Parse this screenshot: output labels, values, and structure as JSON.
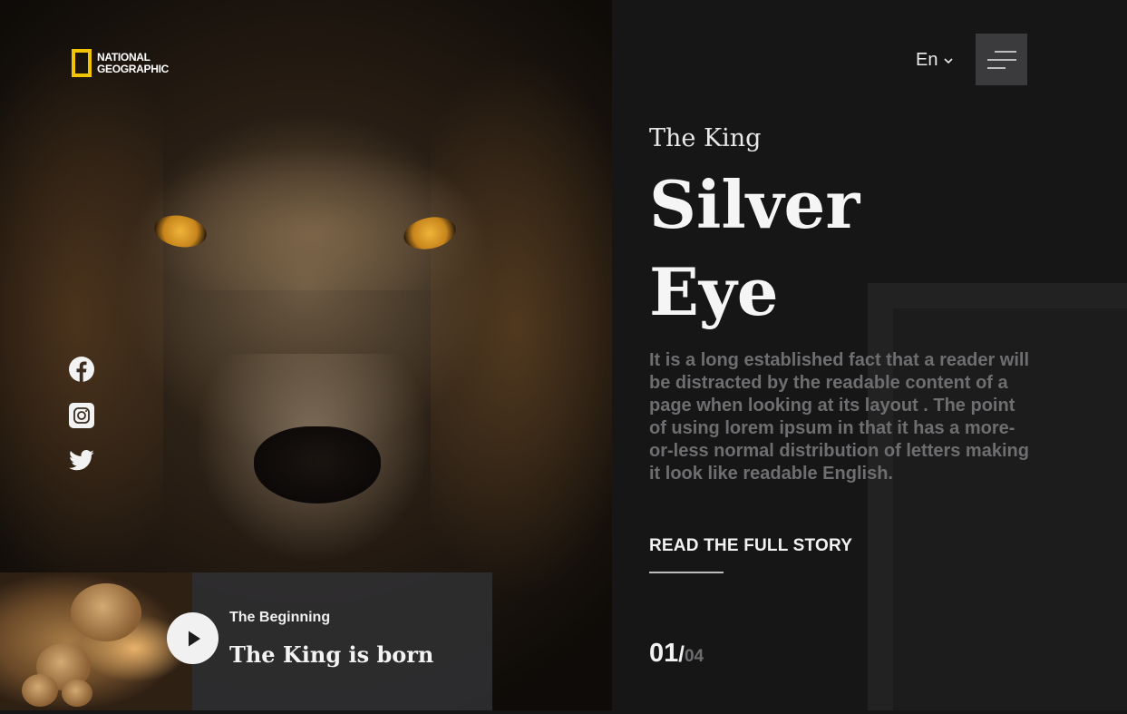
{
  "brand": {
    "logo_text_line1": "NATIONAL",
    "logo_text_line2": "GEOGRAPHIC",
    "logo_color": "#f2c400"
  },
  "header": {
    "language": "En"
  },
  "hero": {
    "kicker": "The King",
    "title": "Silver Eye",
    "body": "It is a long established fact that a reader will be distracted by the readable content of a page when looking at its layout . The point of using lorem ipsum in that it has a more-or-less normal distribution of letters making it look like readable English.",
    "cta": "READ THE FULL STORY"
  },
  "pager": {
    "current": "01",
    "separator": "/",
    "total": "04"
  },
  "video_card": {
    "subtitle": "The Beginning",
    "title": "The King is born"
  },
  "social": [
    "facebook-icon",
    "instagram-icon",
    "twitter-icon"
  ]
}
